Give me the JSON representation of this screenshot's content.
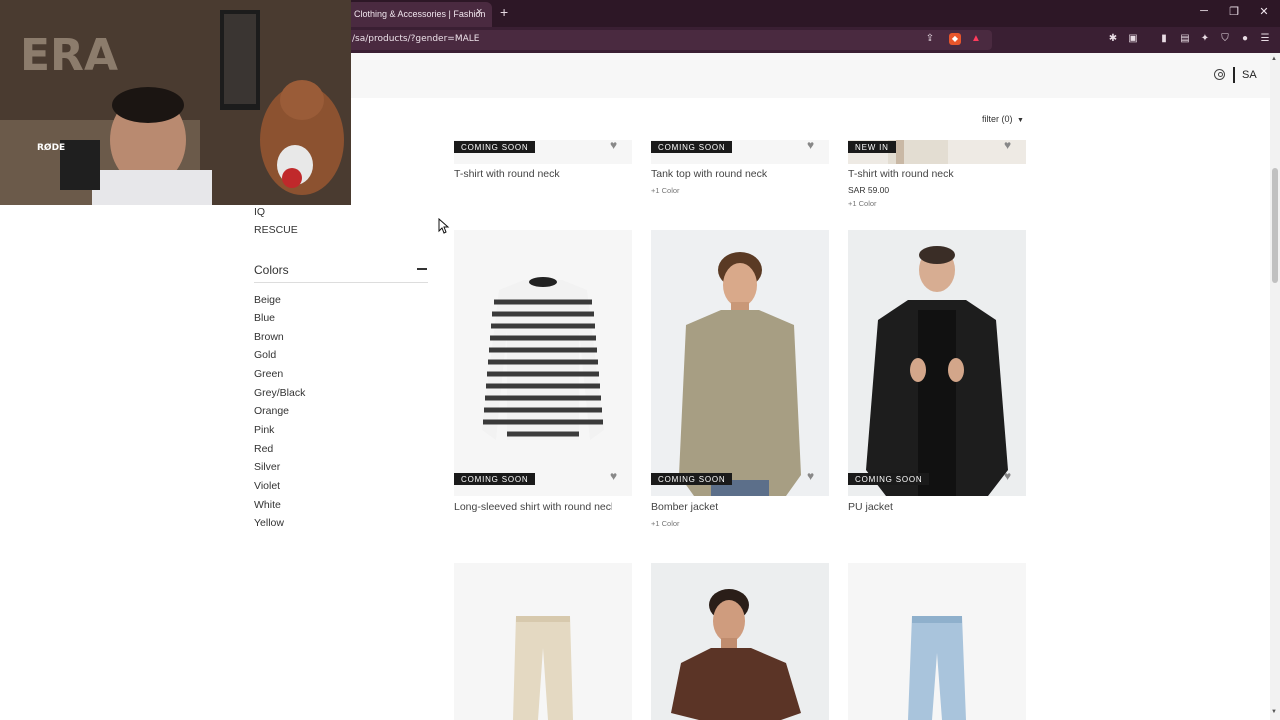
{
  "browser": {
    "tab_title": "Clothing & Accessories | Fashion",
    "tab_close": "×",
    "new_tab": "+",
    "url": "/sa/products/?gender=MALE",
    "minimize": "─",
    "restore": "❐",
    "close": "✕"
  },
  "header": {
    "locale": "SA"
  },
  "filter": {
    "label": "filter (0)"
  },
  "sidebar": {
    "brands_partial": [
      "IQ",
      "RESCUE"
    ],
    "colors_title": "Colors",
    "colors": [
      "Beige",
      "Blue",
      "Brown",
      "Gold",
      "Green",
      "Grey/Black",
      "Orange",
      "Pink",
      "Red",
      "Silver",
      "Violet",
      "White",
      "Yellow"
    ]
  },
  "products": [
    {
      "name": "T-shirt with round neck",
      "badge": "COMING SOON",
      "price": "",
      "colors": ""
    },
    {
      "name": "Tank top with round neck",
      "badge": "COMING SOON",
      "price": "",
      "colors": "+1 Color"
    },
    {
      "name": "T-shirt with round neck",
      "badge": "NEW IN",
      "price": "SAR 59.00",
      "colors": "+1 Color"
    },
    {
      "name": "Long-sleeved shirt with round neck",
      "badge": "COMING SOON",
      "price": "",
      "colors": ""
    },
    {
      "name": "Bomber jacket",
      "badge": "COMING SOON",
      "price": "",
      "colors": "+1 Color"
    },
    {
      "name": "PU jacket",
      "badge": "COMING SOON",
      "price": "",
      "colors": ""
    }
  ],
  "webcam": {
    "mic_brand": "RØDE",
    "wall_text": "ERA"
  }
}
